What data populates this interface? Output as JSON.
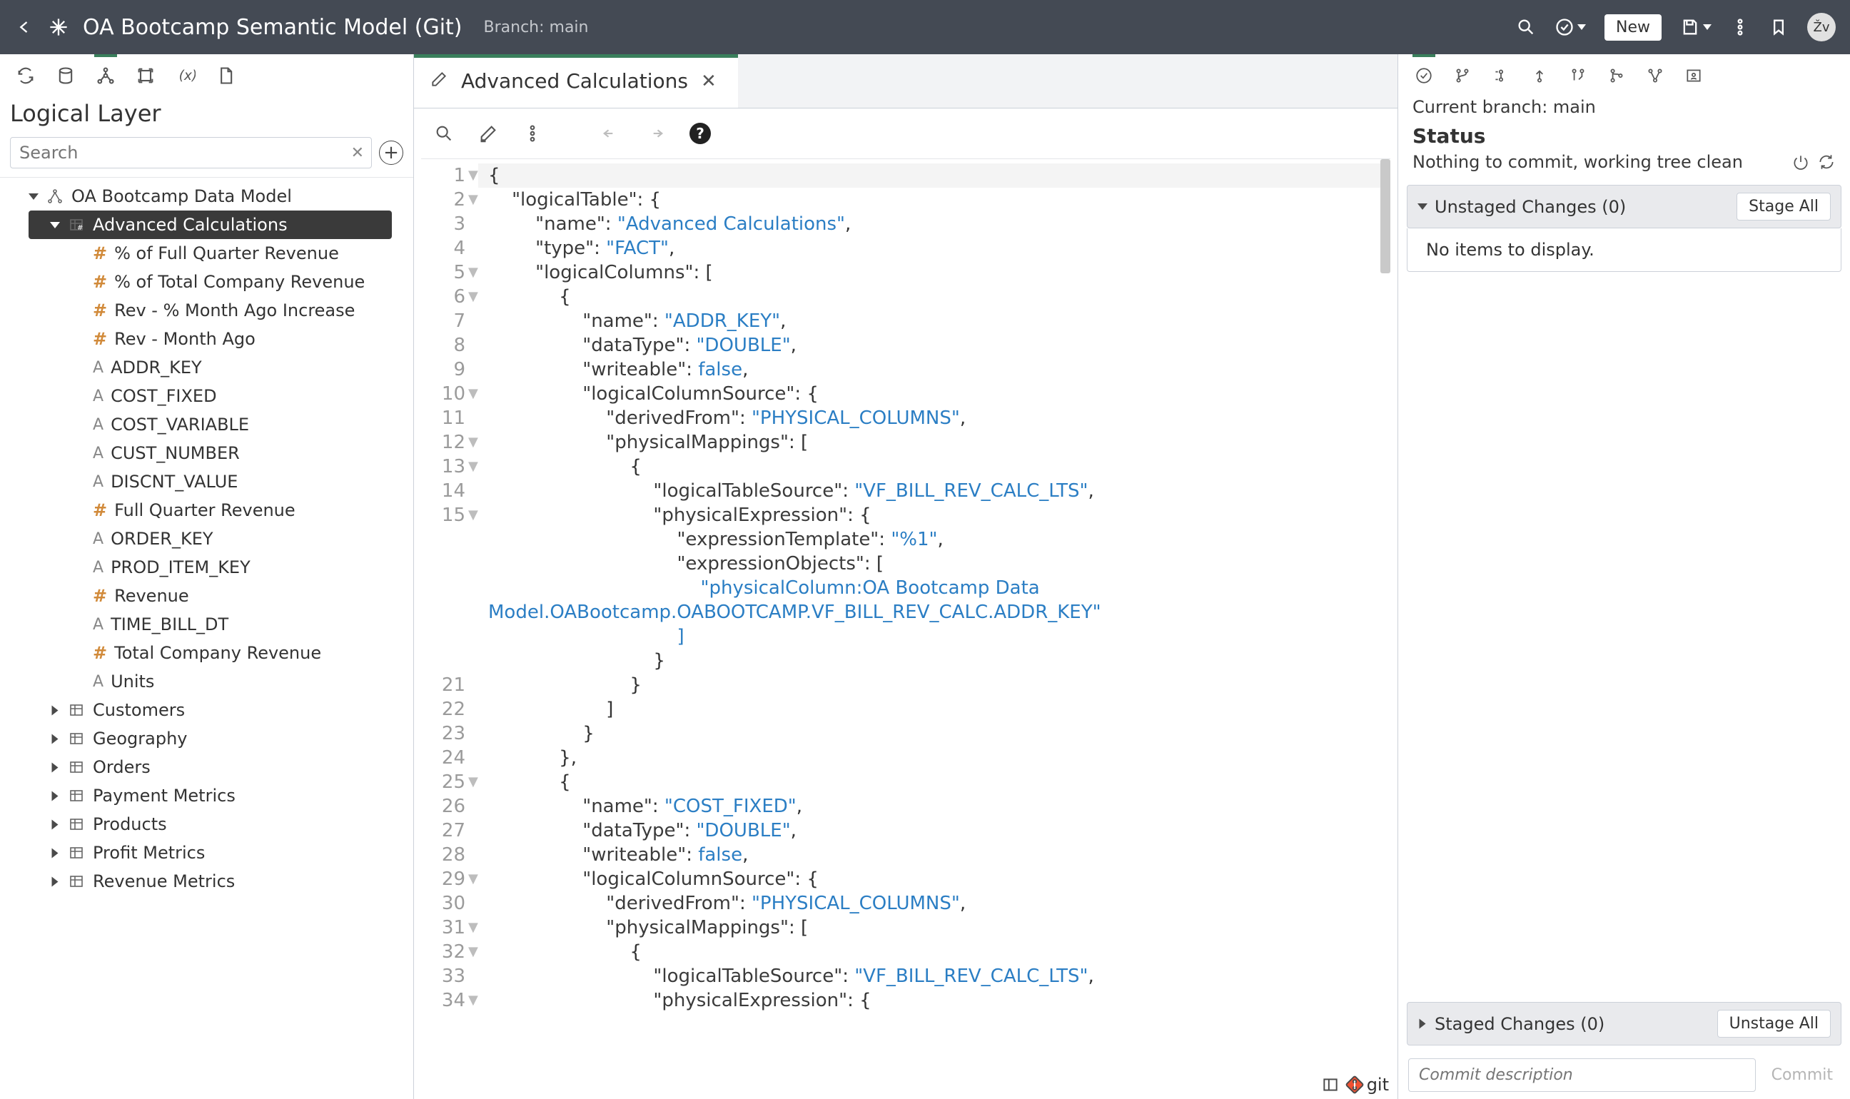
{
  "header": {
    "title": "OA Bootcamp Semantic Model (Git)",
    "branch": "Branch: main",
    "new_btn": "New",
    "avatar": "Žv"
  },
  "left": {
    "layer_title": "Logical Layer",
    "search_placeholder": "Search",
    "root": "OA Bootcamp Data Model",
    "selected": "Advanced Calculations",
    "cols": [
      {
        "t": "hash",
        "n": "% of Full Quarter Revenue"
      },
      {
        "t": "hash",
        "n": "% of Total Company Revenue"
      },
      {
        "t": "hash",
        "n": "Rev - % Month Ago Increase"
      },
      {
        "t": "hash",
        "n": "Rev - Month Ago"
      },
      {
        "t": "a",
        "n": "ADDR_KEY"
      },
      {
        "t": "a",
        "n": "COST_FIXED"
      },
      {
        "t": "a",
        "n": "COST_VARIABLE"
      },
      {
        "t": "a",
        "n": "CUST_NUMBER"
      },
      {
        "t": "a",
        "n": "DISCNT_VALUE"
      },
      {
        "t": "hash",
        "n": "Full Quarter Revenue"
      },
      {
        "t": "a",
        "n": "ORDER_KEY"
      },
      {
        "t": "a",
        "n": "PROD_ITEM_KEY"
      },
      {
        "t": "hash",
        "n": "Revenue"
      },
      {
        "t": "a",
        "n": "TIME_BILL_DT"
      },
      {
        "t": "hash",
        "n": "Total Company Revenue"
      },
      {
        "t": "a",
        "n": "Units"
      }
    ],
    "tables": [
      "Customers",
      "Geography",
      "Orders",
      "Payment Metrics",
      "Products",
      "Profit Metrics",
      "Revenue Metrics"
    ]
  },
  "tab": {
    "label": "Advanced Calculations"
  },
  "code": {
    "lines": [
      {
        "n": 1,
        "f": "▼",
        "t": "{"
      },
      {
        "n": 2,
        "f": "▼",
        "t": "    <k>\"logicalTable\"</k>: {"
      },
      {
        "n": 3,
        "t": "        <k>\"name\"</k>: <s>\"Advanced Calculations\"</s>,"
      },
      {
        "n": 4,
        "t": "        <k>\"type\"</k>: <s>\"FACT\"</s>,"
      },
      {
        "n": 5,
        "f": "▼",
        "t": "        <k>\"logicalColumns\"</k>: ["
      },
      {
        "n": 6,
        "f": "▼",
        "t": "            {"
      },
      {
        "n": 7,
        "t": "                <k>\"name\"</k>: <s>\"ADDR_KEY\"</s>,"
      },
      {
        "n": 8,
        "t": "                <k>\"dataType\"</k>: <s>\"DOUBLE\"</s>,"
      },
      {
        "n": 9,
        "t": "                <k>\"writeable\"</k>: <b>false</b>,"
      },
      {
        "n": 10,
        "f": "▼",
        "t": "                <k>\"logicalColumnSource\"</k>: {"
      },
      {
        "n": 11,
        "t": "                    <k>\"derivedFrom\"</k>: <s>\"PHYSICAL_COLUMNS\"</s>,"
      },
      {
        "n": 12,
        "f": "▼",
        "t": "                    <k>\"physicalMappings\"</k>: ["
      },
      {
        "n": 13,
        "f": "▼",
        "t": "                        {"
      },
      {
        "n": 14,
        "t": "                            <k>\"logicalTableSource\"</k>: <s>\"VF_BILL_REV_CALC_LTS\"</s>,"
      },
      {
        "n": 15,
        "f": "▼",
        "t": "                            <k>\"physicalExpression\"</k>: {"
      },
      {
        "n": 0,
        "t": "                                <k>\"expressionTemplate\"</k>: <s>\"%1\"</s>,"
      },
      {
        "n": 0,
        "t": "                                <k>\"expressionObjects\"</k>: ["
      },
      {
        "n": 0,
        "t": "                                    <s>\"physicalColumn:OA Bootcamp Data </s>"
      },
      {
        "n": 0,
        "t": "<s>Model.OABootcamp.OABOOTCAMP.VF_BILL_REV_CALC.ADDR_KEY\"</s>"
      },
      {
        "n": 0,
        "t": "                                <s>]</s>"
      },
      {
        "n": 0,
        "t": "                            }"
      },
      {
        "n": 21,
        "t": "                        }"
      },
      {
        "n": 22,
        "t": "                    ]"
      },
      {
        "n": 23,
        "t": "                }"
      },
      {
        "n": 24,
        "t": "            },"
      },
      {
        "n": 25,
        "f": "▼",
        "t": "            {"
      },
      {
        "n": 26,
        "t": "                <k>\"name\"</k>: <s>\"COST_FIXED\"</s>,"
      },
      {
        "n": 27,
        "t": "                <k>\"dataType\"</k>: <s>\"DOUBLE\"</s>,"
      },
      {
        "n": 28,
        "t": "                <k>\"writeable\"</k>: <b>false</b>,"
      },
      {
        "n": 29,
        "f": "▼",
        "t": "                <k>\"logicalColumnSource\"</k>: {"
      },
      {
        "n": 30,
        "t": "                    <k>\"derivedFrom\"</k>: <s>\"PHYSICAL_COLUMNS\"</s>,"
      },
      {
        "n": 31,
        "f": "▼",
        "t": "                    <k>\"physicalMappings\"</k>: ["
      },
      {
        "n": 32,
        "f": "▼",
        "t": "                        {"
      },
      {
        "n": 33,
        "t": "                            <k>\"logicalTableSource\"</k>: <s>\"VF_BILL_REV_CALC_LTS\"</s>,"
      },
      {
        "n": 34,
        "f": "▼",
        "t": "                            <k>\"physicalExpression\"</k>: {"
      }
    ]
  },
  "right": {
    "branch": "Current branch: main",
    "status": "Status",
    "nothing": "Nothing to commit, working tree clean",
    "unstaged": "Unstaged Changes (0)",
    "stage_all": "Stage All",
    "no_items": "No items to display.",
    "staged": "Staged Changes (0)",
    "unstage_all": "Unstage All",
    "commit_ph": "Commit description",
    "commit_btn": "Commit",
    "git_label": "git"
  }
}
